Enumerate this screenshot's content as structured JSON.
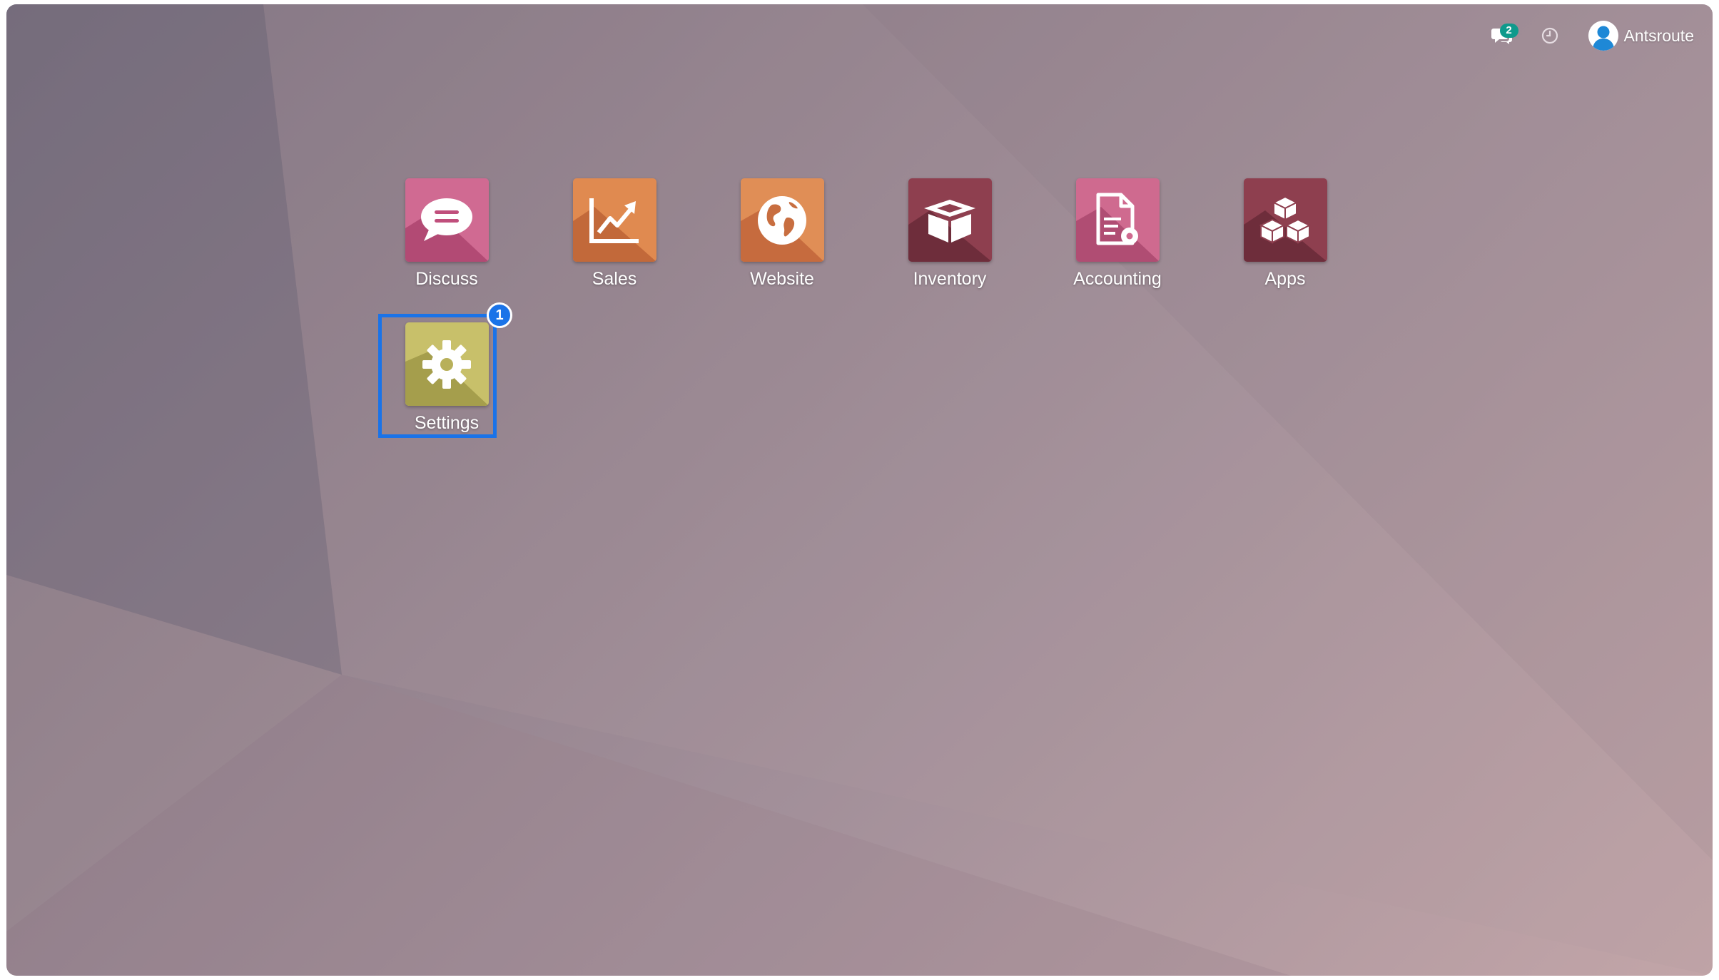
{
  "systray": {
    "messages_badge": "2",
    "user_name": "Antsroute"
  },
  "apps": [
    {
      "label": "Discuss",
      "icon": "chat-bubble-icon",
      "colors": [
        "#d06a92",
        "#b24a74"
      ]
    },
    {
      "label": "Sales",
      "icon": "trending-chart-icon",
      "colors": [
        "#e08a50",
        "#c2693a"
      ]
    },
    {
      "label": "Website",
      "icon": "globe-icon",
      "colors": [
        "#e08e56",
        "#c66b3e"
      ]
    },
    {
      "label": "Inventory",
      "icon": "open-box-icon",
      "colors": [
        "#8e3f4f",
        "#6e2d3b"
      ]
    },
    {
      "label": "Accounting",
      "icon": "document-gear-icon",
      "colors": [
        "#cf6a8f",
        "#b04d73"
      ]
    },
    {
      "label": "Apps",
      "icon": "cubes-icon",
      "colors": [
        "#8e3f4f",
        "#6e2d3b"
      ]
    },
    {
      "label": "Settings",
      "icon": "gear-icon",
      "colors": [
        "#c8c06a",
        "#a59e4c"
      ]
    }
  ],
  "highlight": {
    "badge_number": "1",
    "color": "#1a73e8"
  }
}
